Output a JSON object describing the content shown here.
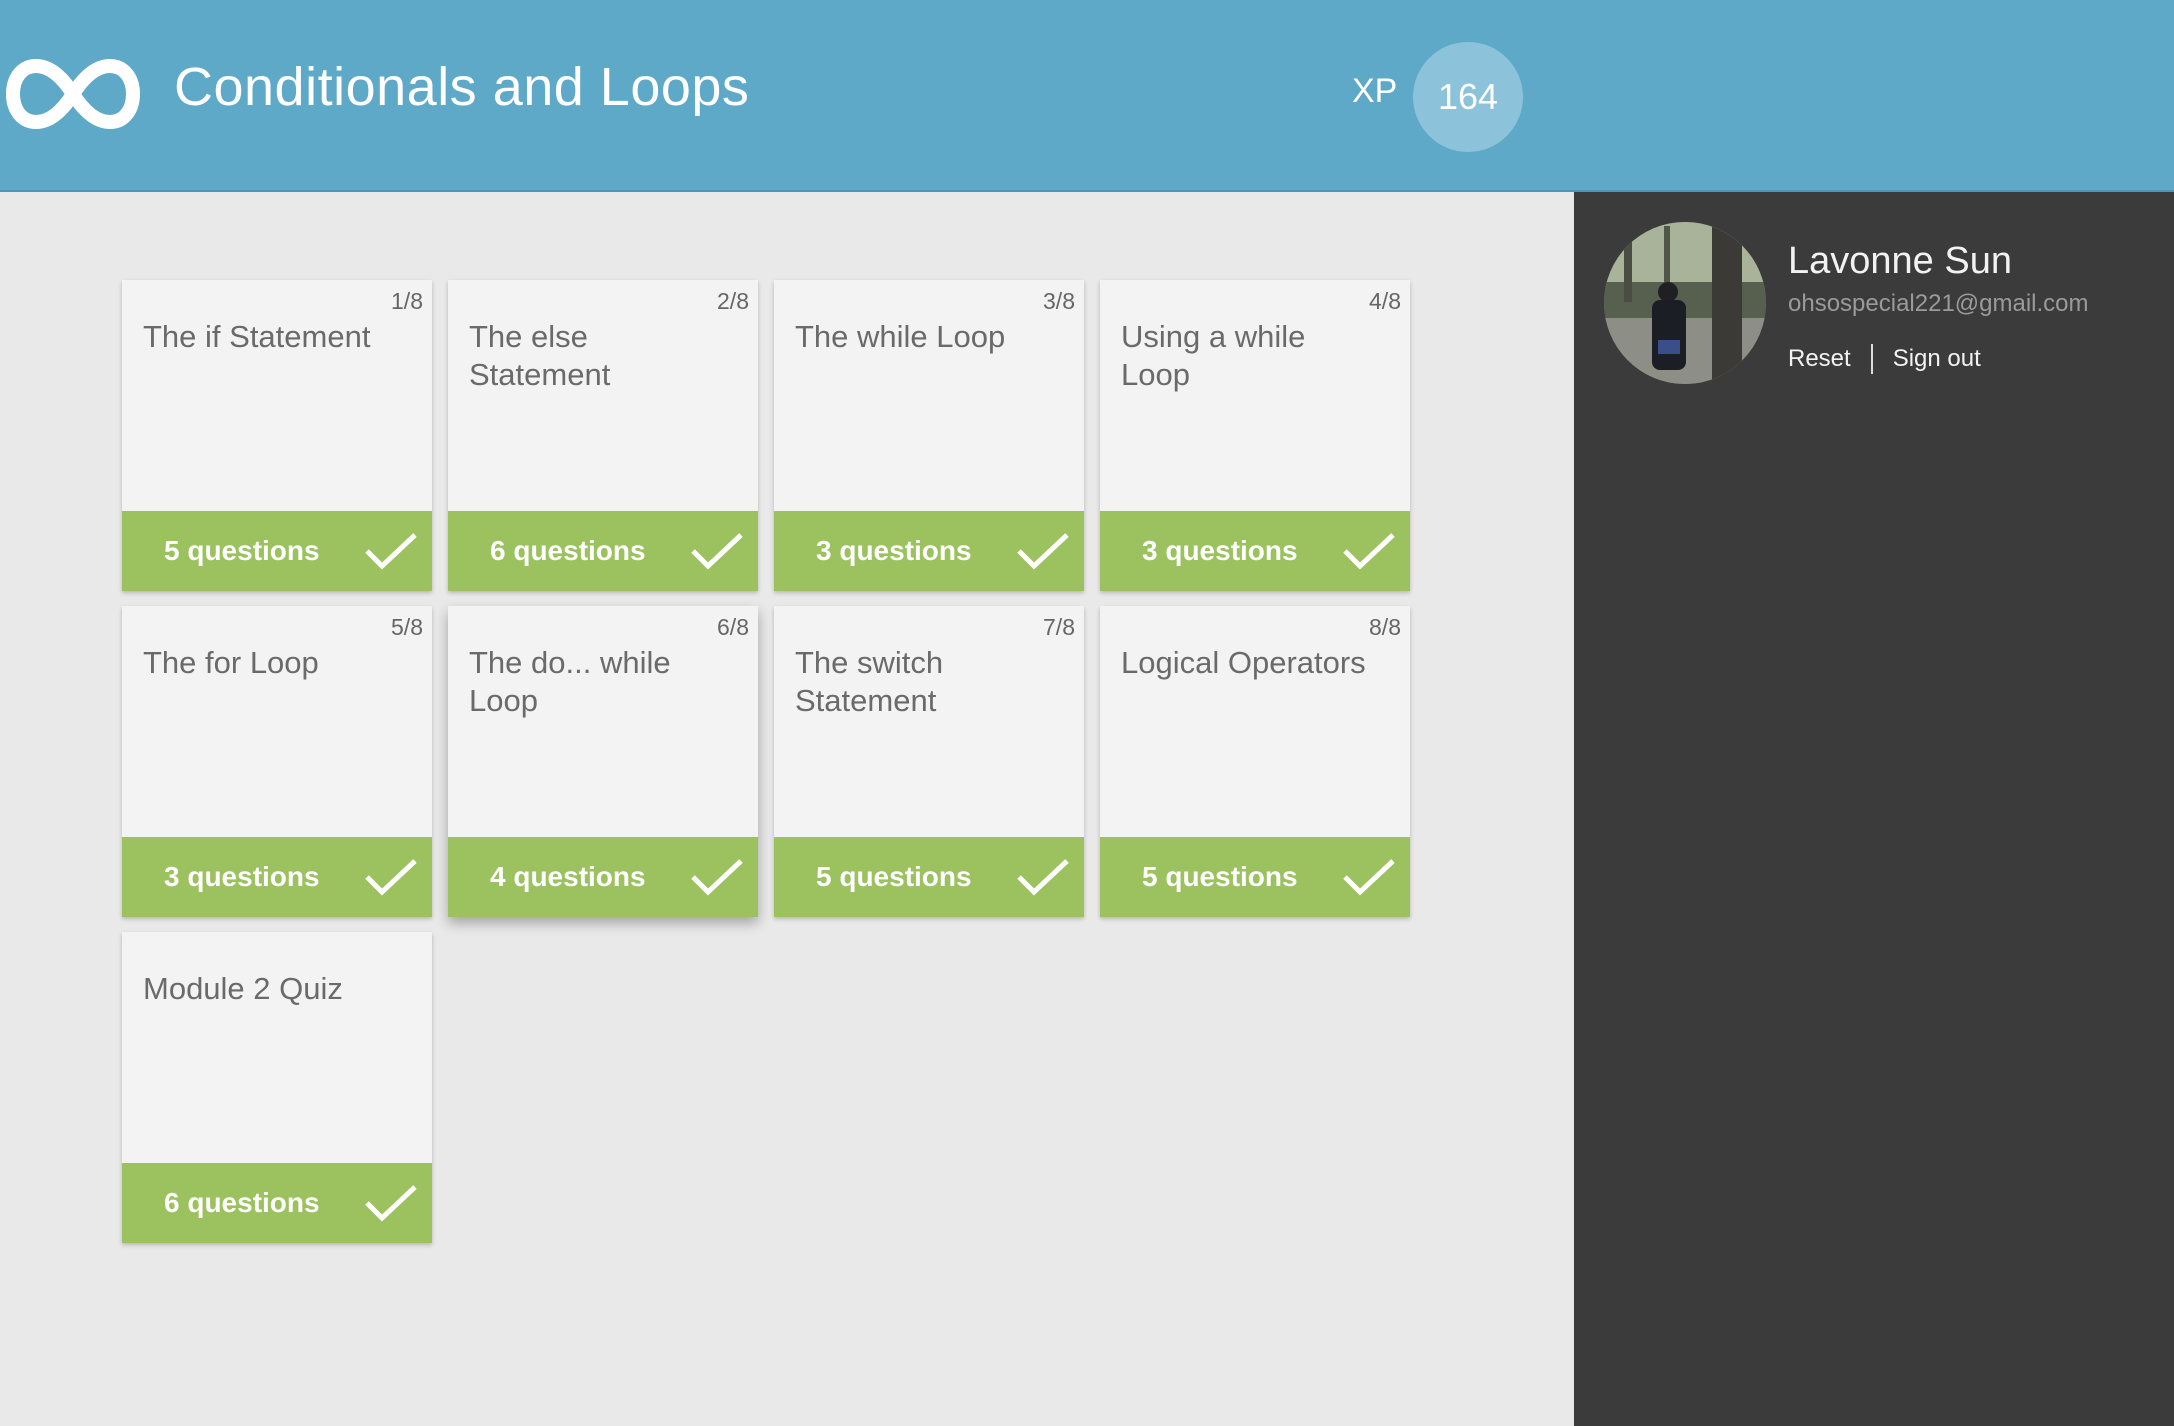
{
  "header": {
    "title": "Conditionals and Loops",
    "xp_label": "XP",
    "xp_value": "164",
    "logo_icon": "infinity-logo-icon"
  },
  "user": {
    "name": "Lavonne Sun",
    "email": "ohsospecial221@gmail.com",
    "reset_label": "Reset",
    "signout_label": "Sign out"
  },
  "colors": {
    "header": "#5ea8c8",
    "sidebar": "#3b3b3b",
    "card_footer": "#9bc25e",
    "background": "#e9e9e9"
  },
  "lessons": [
    {
      "number": "1/8",
      "title": "The if Statement",
      "questions": "5 questions",
      "completed": true
    },
    {
      "number": "2/8",
      "title": "The else Statement",
      "questions": "6 questions",
      "completed": true
    },
    {
      "number": "3/8",
      "title": "The while Loop",
      "questions": "3 questions",
      "completed": true
    },
    {
      "number": "4/8",
      "title": "Using a while Loop",
      "questions": "3 questions",
      "completed": true
    },
    {
      "number": "5/8",
      "title": "The for Loop",
      "questions": "3 questions",
      "completed": true
    },
    {
      "number": "6/8",
      "title": "The do... while Loop",
      "questions": "4 questions",
      "completed": true
    },
    {
      "number": "7/8",
      "title": "The switch Statement",
      "questions": "5 questions",
      "completed": true
    },
    {
      "number": "8/8",
      "title": "Logical Operators",
      "questions": "5 questions",
      "completed": true
    },
    {
      "number": "",
      "title": "Module 2 Quiz",
      "questions": "6 questions",
      "completed": true
    }
  ]
}
